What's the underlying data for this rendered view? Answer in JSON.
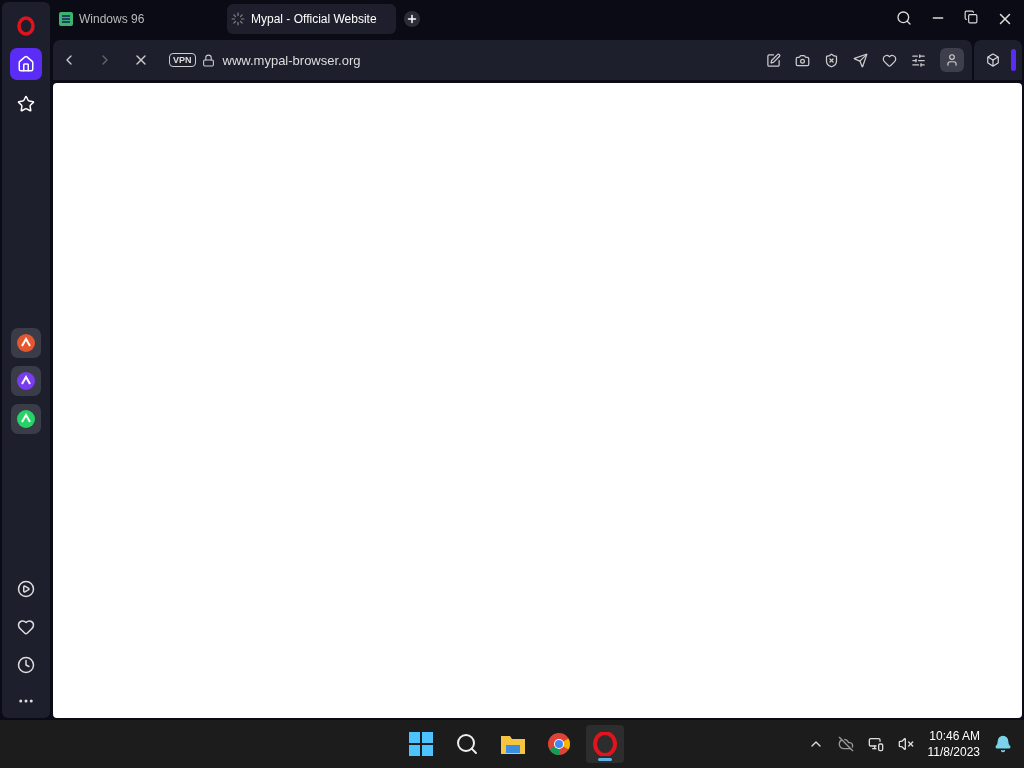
{
  "tabs": [
    {
      "title": "Windows 96",
      "selected": false,
      "loading": false
    },
    {
      "title": "Mypal - Official Website",
      "selected": true,
      "loading": true
    }
  ],
  "toolbar": {
    "vpn": "VPN",
    "address": "www.mypal-browser.org",
    "loading": true
  },
  "sidebar": {
    "items": [
      {
        "kind": "home",
        "selected": true
      },
      {
        "kind": "speed-dial",
        "selected": false
      }
    ],
    "apps": [
      {
        "kind": "aria"
      },
      {
        "kind": "messenger"
      },
      {
        "kind": "whatsapp"
      }
    ]
  },
  "taskbar": {
    "time": "10:46 AM",
    "date": "11/8/2023",
    "apps": [
      {
        "kind": "search",
        "selected": false
      },
      {
        "kind": "files",
        "selected": false
      },
      {
        "kind": "chrome",
        "selected": false
      },
      {
        "kind": "opera",
        "selected": true
      }
    ]
  }
}
